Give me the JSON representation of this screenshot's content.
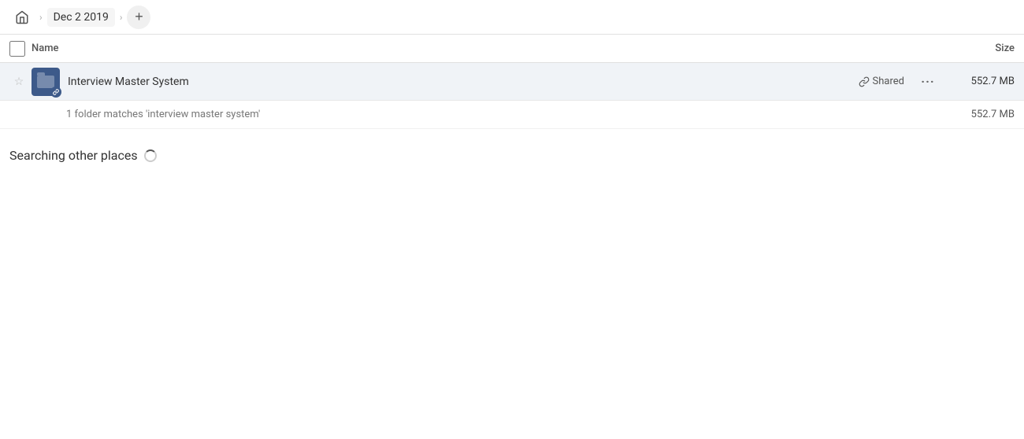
{
  "breadcrumb": {
    "home_label": "Home",
    "date_label": "Dec 2 2019",
    "add_button_label": "+"
  },
  "columns": {
    "name_label": "Name",
    "size_label": "Size"
  },
  "file_row": {
    "name": "Interview Master System",
    "shared_label": "Shared",
    "size": "552.7 MB",
    "more_label": "···"
  },
  "match_info": {
    "text": "1 folder matches 'interview master system'",
    "size": "552.7 MB"
  },
  "searching_section": {
    "title": "Searching other places"
  },
  "icons": {
    "star": "☆",
    "home": "⌂",
    "link": "🔗",
    "ellipsis": "···"
  }
}
